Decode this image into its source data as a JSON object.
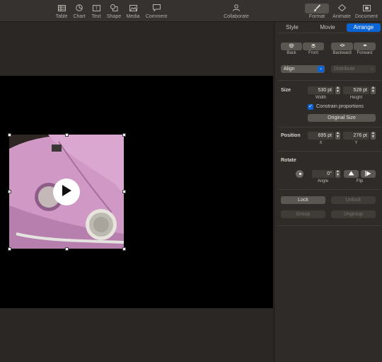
{
  "toolbar": {
    "items": [
      {
        "label": "Table",
        "icon": "table-icon"
      },
      {
        "label": "Chart",
        "icon": "chart-icon"
      },
      {
        "label": "Text",
        "icon": "text-icon"
      },
      {
        "label": "Shape",
        "icon": "shape-icon"
      },
      {
        "label": "Media",
        "icon": "media-icon"
      },
      {
        "label": "Comment",
        "icon": "comment-icon"
      }
    ],
    "collaborate": "Collaborate",
    "right_items": [
      {
        "label": "Format",
        "icon": "paintbrush-icon"
      },
      {
        "label": "Animate",
        "icon": "diamond-icon"
      },
      {
        "label": "Document",
        "icon": "document-icon"
      }
    ]
  },
  "inspector": {
    "tabs": [
      "Style",
      "Movie",
      "Arrange"
    ],
    "active_tab": "Arrange",
    "layer": {
      "back": "Back",
      "front": "Front",
      "backward": "Backward",
      "forward": "Forward"
    },
    "align": "Align",
    "distribute": "Distribute",
    "size": {
      "title": "Size",
      "width": "530 pt",
      "height": "528 pt",
      "width_label": "Width",
      "height_label": "Height",
      "constrain": "Constrain proportions",
      "original": "Original Size"
    },
    "position": {
      "title": "Position",
      "x": "695 pt",
      "y": "276 pt",
      "x_label": "X",
      "y_label": "Y"
    },
    "rotate": {
      "title": "Rotate",
      "angle": "0°",
      "angle_label": "Angle",
      "flip_label": "Flip"
    },
    "lock": "Lock",
    "unlock": "Unlock",
    "group": "Group",
    "ungroup": "Ungroup"
  },
  "colors": {
    "accent": "#0a64d6",
    "photo_pink": "#c88fbe"
  }
}
